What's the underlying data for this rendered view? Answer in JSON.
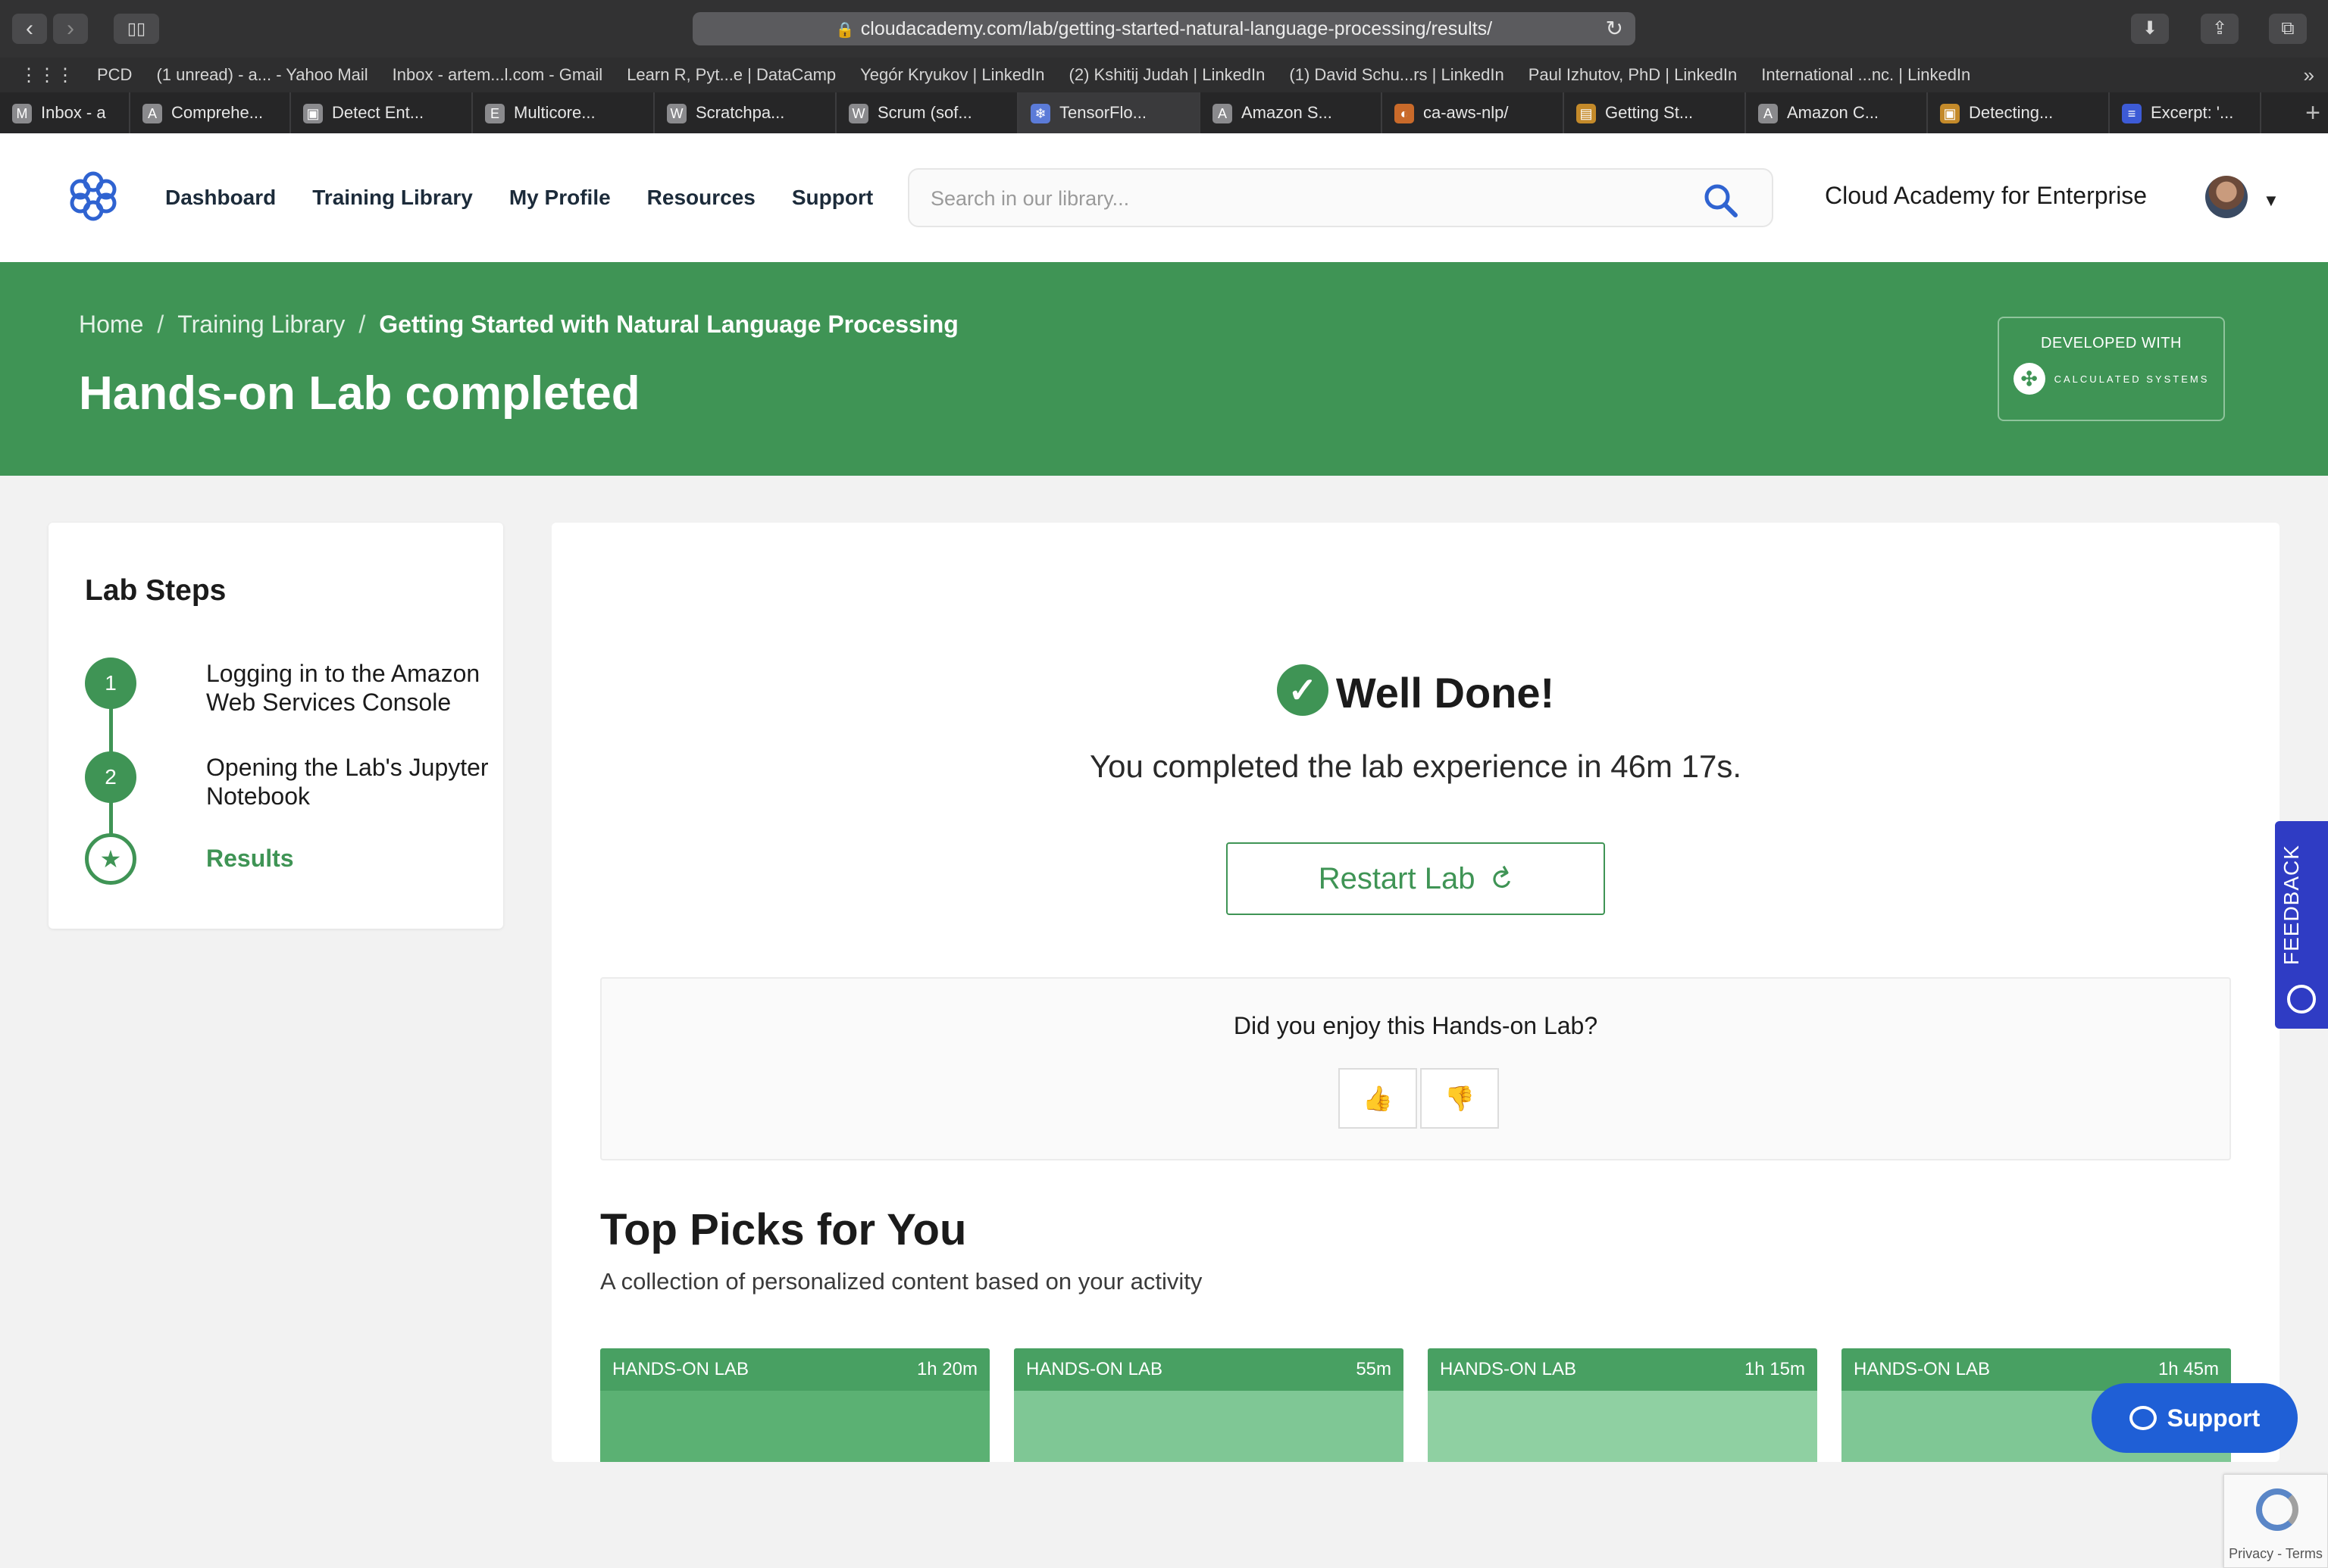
{
  "browser": {
    "url": "cloudacademy.com/lab/getting-started-natural-language-processing/results/",
    "favorites": [
      "PCD",
      "(1 unread) - a... - Yahoo Mail",
      "Inbox - artem...l.com - Gmail",
      "Learn R, Pyt...e | DataCamp",
      "Yegór Kryukov | LinkedIn",
      "(2) Kshitij Judah | LinkedIn",
      "(1) David Schu...rs | LinkedIn",
      "Paul Izhutov, PhD | LinkedIn",
      "International ...nc. | LinkedIn"
    ],
    "tabs": [
      {
        "label": "Inbox - a",
        "icon": "M"
      },
      {
        "label": "Comprehe...",
        "icon": "A"
      },
      {
        "label": "Detect Ent...",
        "icon": "▣"
      },
      {
        "label": "Multicore...",
        "icon": "E"
      },
      {
        "label": "Scratchpa...",
        "icon": "W"
      },
      {
        "label": "Scrum (sof...",
        "icon": "W"
      },
      {
        "label": "TensorFlo...",
        "icon": "❄"
      },
      {
        "label": "Amazon S...",
        "icon": "A"
      },
      {
        "label": "ca-aws-nlp/",
        "icon": "◐"
      },
      {
        "label": "Getting St...",
        "icon": "▤"
      },
      {
        "label": "Amazon C...",
        "icon": "A"
      },
      {
        "label": "Detecting...",
        "icon": "▣"
      },
      {
        "label": "Excerpt: '...",
        "icon": "≡"
      }
    ]
  },
  "header": {
    "nav": [
      "Dashboard",
      "Training Library",
      "My Profile",
      "Resources",
      "Support"
    ],
    "search_placeholder": "Search in our library...",
    "enterprise": "Cloud Academy for Enterprise"
  },
  "banner": {
    "crumbs": [
      "Home",
      "Training Library",
      "Getting Started with Natural Language Processing"
    ],
    "title": "Hands-on Lab completed",
    "developed_with": "DEVELOPED WITH",
    "partner": "CALCULATED SYSTEMS"
  },
  "steps": {
    "title": "Lab Steps",
    "items": [
      {
        "num": "1",
        "label": "Logging in to the Amazon Web Services Console"
      },
      {
        "num": "2",
        "label": "Opening the Lab's Jupyter Notebook"
      },
      {
        "num": "★",
        "label": "Results"
      }
    ]
  },
  "result": {
    "heading": "Well Done!",
    "message": "You completed the lab experience in 46m 17s.",
    "restart": "Restart Lab",
    "enjoy_question": "Did you enjoy this Hands-on Lab?"
  },
  "picks": {
    "title": "Top Picks for You",
    "subtitle": "A collection of personalized content based on your activity",
    "cards": [
      {
        "type": "HANDS-ON LAB",
        "duration": "1h 20m"
      },
      {
        "type": "HANDS-ON LAB",
        "duration": "55m"
      },
      {
        "type": "HANDS-ON LAB",
        "duration": "1h 15m"
      },
      {
        "type": "HANDS-ON LAB",
        "duration": "1h 45m"
      }
    ]
  },
  "widgets": {
    "feedback": "FEEDBACK",
    "support": "Support",
    "recaptcha": "Privacy - Terms"
  }
}
